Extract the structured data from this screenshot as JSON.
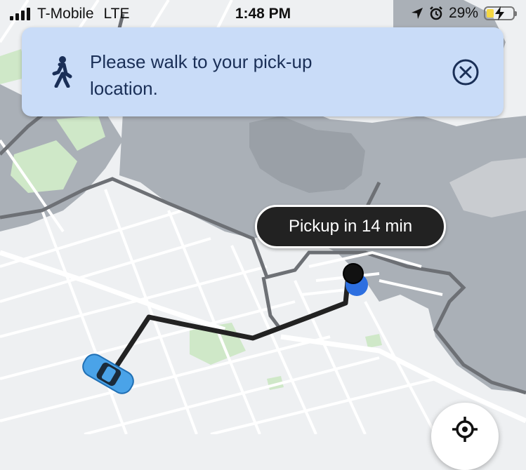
{
  "status_bar": {
    "carrier": "T-Mobile",
    "network": "LTE",
    "time": "1:48 PM",
    "battery": "29%",
    "battery_level": 0.29,
    "icons": [
      "location-arrow-icon",
      "alarm-icon",
      "battery-charging-icon"
    ]
  },
  "banner": {
    "message": "Please walk to your pick-up location.",
    "icon": "walking-person-icon",
    "close_icon": "close-circle-icon",
    "background_color": "#c9dcf8",
    "text_color": "#1a2f57"
  },
  "map": {
    "pickup_label": "Pickup in 14 min",
    "route_color": "#222222",
    "pickup_marker_color": "#2d6fe0",
    "car_color": "#4aa3e8",
    "water_color": "#aab0b7",
    "land_color": "#eef0f2",
    "park_color": "#cfe8c8",
    "airport_zone_color": "#6d7075"
  },
  "controls": {
    "locate_icon": "locate-me-icon"
  }
}
